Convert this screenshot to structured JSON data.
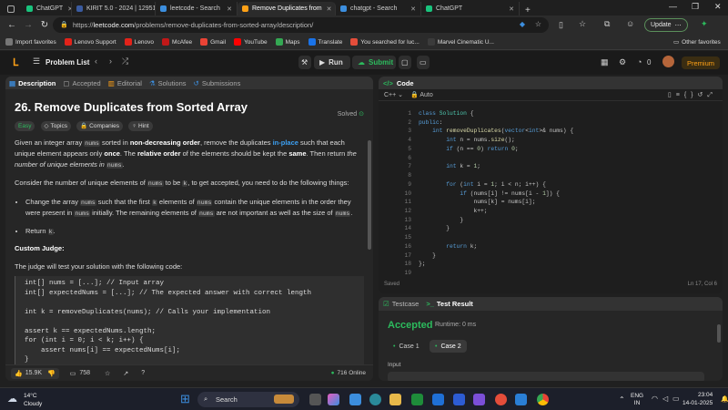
{
  "browser": {
    "tabs": [
      {
        "label": "ChatGPT",
        "color": "#19c37d"
      },
      {
        "label": "KIRIT 5.0 - 2024 | 129512i",
        "color": "#3a5ba0"
      },
      {
        "label": "leetcode - Search",
        "color": "#3c8ede"
      },
      {
        "label": "Remove Duplicates from",
        "color": "#ffa116"
      },
      {
        "label": "chatgpt - Search",
        "color": "#3c8ede"
      },
      {
        "label": "ChatGPT",
        "color": "#19c37d"
      }
    ],
    "new_tab": "+",
    "url_prefix": "https://",
    "url_host": "leetcode.com",
    "url_path": "/problems/remove-duplicates-from-sorted-array/description/",
    "update_label": "Update",
    "bookmarks": [
      "Import favorites",
      "Lenovo Support",
      "Lenovo",
      "McAfee",
      "Gmail",
      "YouTube",
      "Maps",
      "Translate",
      "You searched for luc...",
      "Marvel Cinematic U..."
    ],
    "bookmarks_other": "Other favorites"
  },
  "leetcode": {
    "problem_list": "Problem List",
    "run": "Run",
    "submit": "Submit",
    "coins": "0",
    "premium": "Premium"
  },
  "left_tabs": {
    "description": "Description",
    "accepted": "Accepted",
    "editorial": "Editorial",
    "solutions": "Solutions",
    "submissions": "Submissions"
  },
  "problem": {
    "title": "26. Remove Duplicates from Sorted Array",
    "status": "Solved",
    "difficulty": "Easy",
    "topics": "Topics",
    "companies": "Companies",
    "hint": "Hint",
    "p1_a": "Given an integer array ",
    "p1_code1": "nums",
    "p1_b": " sorted in ",
    "p1_bold1": "non-decreasing order",
    "p1_c": ", remove the duplicates ",
    "p1_blue": "in-place",
    "p1_d": " such that each unique element appears only ",
    "p1_bold2": "once",
    "p1_e": ". The ",
    "p1_bold3": "relative order",
    "p1_f": " of the elements should be kept the ",
    "p1_bold4": "same",
    "p1_g": ". Then return ",
    "p1_ital": "the number of unique elements in",
    "p1_code2": "nums",
    "p1_h": ".",
    "p2_a": "Consider the number of unique elements of ",
    "p2_code1": "nums",
    "p2_b": " to be ",
    "p2_code2": "k",
    "p2_c": ", to get accepted, you need to do the following things:",
    "li1_a": "Change the array ",
    "li1_code1": "nums",
    "li1_b": " such that the first ",
    "li1_code2": "k",
    "li1_c": " elements of ",
    "li1_code3": "nums",
    "li1_d": " contain the unique elements in the order they were present in ",
    "li1_code4": "nums",
    "li1_e": " initially. The remaining elements of ",
    "li1_code5": "nums",
    "li1_f": " are not important as well as the size of ",
    "li1_code6": "nums",
    "li1_g": ".",
    "li2_a": "Return ",
    "li2_code": "k",
    "li2_b": ".",
    "judge_heading": "Custom Judge:",
    "judge_text": "The judge will test your solution with the following code:",
    "judge_code": "int[] nums = [...]; // Input array\nint[] expectedNums = [...]; // The expected answer with correct length\n\nint k = removeDuplicates(nums); // Calls your implementation\n\nassert k == expectedNums.length;\nfor (int i = 0; i < k; i++) {\n    assert nums[i] == expectedNums[i];\n}"
  },
  "left_footer": {
    "likes": "15.9K",
    "comments": "758",
    "online": "716 Online"
  },
  "editor": {
    "title": "Code",
    "language": "C++",
    "auto": "Auto",
    "lines": [
      "class Solution {",
      "public:",
      "    int removeDuplicates(vector<int>& nums) {",
      "        int n = nums.size();",
      "        if (n == 0) return 0;",
      "",
      "        int k = 1;",
      "",
      "        for (int i = 1; i < n; i++) {",
      "            if (nums[i] != nums[i - 1]) {",
      "                nums[k] = nums[i];",
      "                k++;",
      "            }",
      "        }",
      "",
      "        return k;",
      "    }",
      "};",
      ""
    ],
    "saved": "Saved",
    "position": "Ln 17, Col 6"
  },
  "result": {
    "testcase_tab": "Testcase",
    "result_tab": "Test Result",
    "verdict": "Accepted",
    "runtime": "Runtime: 0 ms",
    "case1": "Case 1",
    "case2": "Case 2",
    "input_label": "Input"
  },
  "taskbar": {
    "temp": "14°C",
    "weather": "Cloudy",
    "search": "Search",
    "lang1": "ENG",
    "lang2": "IN",
    "time": "23:04",
    "date": "14-01-2025"
  }
}
